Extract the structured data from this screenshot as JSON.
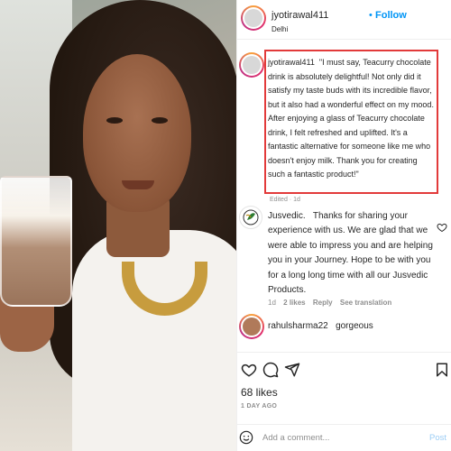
{
  "post": {
    "username": "jyotirawal411",
    "location": "Delhi",
    "follow_label": "Follow",
    "follow_dot": "•"
  },
  "caption": {
    "username": "jyotirawal411",
    "text": "\"I must say, Teacurry chocolate drink is absolutely delightful! Not only did it satisfy my taste buds with its incredible flavor, but it also had a wonderful effect on my mood. After enjoying a glass of Teacurry chocolate drink, I felt refreshed and uplifted. It's a fantastic alternative for someone like me who doesn't enjoy milk. Thank you for creating such a fantastic product!\"",
    "meta": "Edited · 1d"
  },
  "reply": {
    "username": "Jusvedic.",
    "text": "Thanks for sharing your experience with us. We are glad that we were able to impress you and are helping you in your Journey. Hope to be with you for a long long time with all our Jusvedic Products.",
    "time": "1d",
    "likes": "2 likes",
    "reply_label": "Reply",
    "translation_label": "See translation"
  },
  "comment2": {
    "username": "rahulsharma22",
    "text": "gorgeous"
  },
  "actions": {
    "likes": "68 likes",
    "time_ago": "1 DAY AGO"
  },
  "add_comment": {
    "placeholder": "Add a comment...",
    "post_label": "Post"
  },
  "colors": {
    "accent": "#0095f6",
    "highlight_border": "#e23a3a"
  },
  "icons": [
    "heart-icon",
    "comment-icon",
    "share-icon",
    "bookmark-icon",
    "smiley-icon"
  ]
}
